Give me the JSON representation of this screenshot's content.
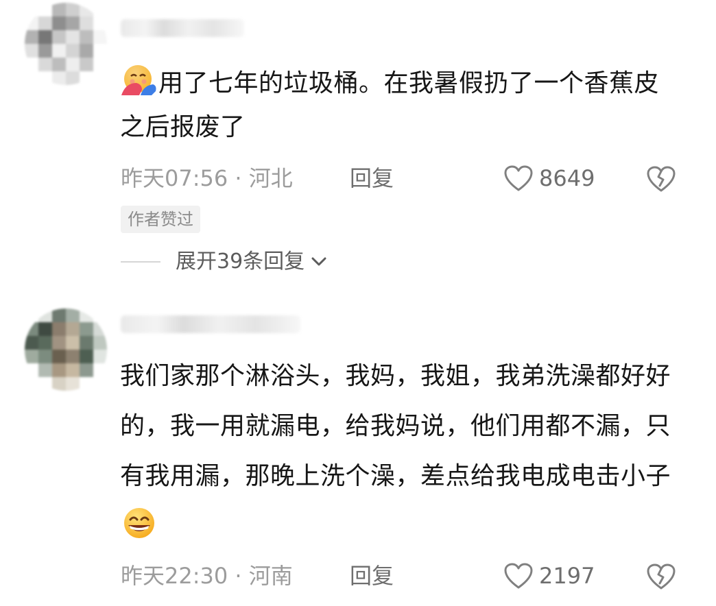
{
  "comments": [
    {
      "text": "用了七年的垃圾桶。在我暑假扔了一个香蕉皮之后报废了",
      "emoji_lead": "hugging-face-emoji",
      "time_location": "昨天07:56 · 河北",
      "reply_label": "回复",
      "likes": "8649",
      "author_tag": "作者赞过",
      "expand_label": "展开39条回复"
    },
    {
      "text": "我们家那个淋浴头，我妈，我姐，我弟洗澡都好好的，我一用就漏电，给我妈说，他们用都不漏，只有我用漏，那晚上洗个澡，差点给我电成电击小子",
      "emoji_trail": "grinning-face-emoji",
      "time_location": "昨天22:30 · 河南",
      "reply_label": "回复",
      "likes": "2197"
    }
  ],
  "colors": {
    "text": "#161616",
    "meta": "#9c9c9c",
    "tag_bg": "#f1f1f1"
  }
}
